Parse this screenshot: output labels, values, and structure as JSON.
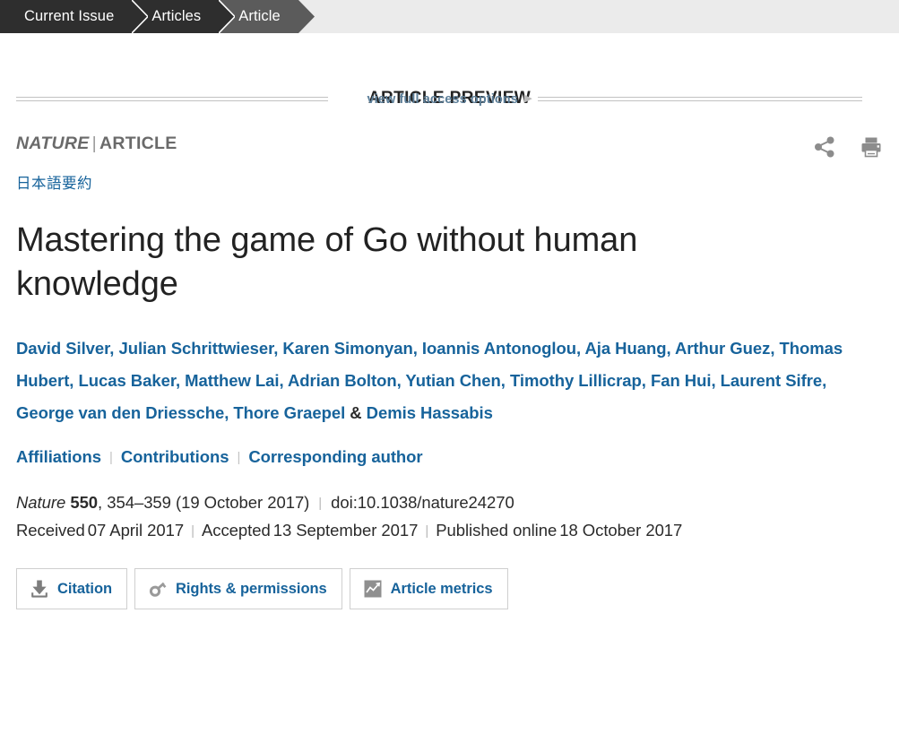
{
  "breadcrumb": {
    "items": [
      {
        "label": "Current Issue",
        "state": "dark"
      },
      {
        "label": "Articles",
        "state": "dark"
      },
      {
        "label": "Article",
        "state": "current"
      }
    ]
  },
  "preview": {
    "title": "ARTICLE PREVIEW",
    "subtitle": "view full access options",
    "caret": "▶"
  },
  "kicker": {
    "journal": "NATURE",
    "separator": "|",
    "type": "ARTICLE"
  },
  "tools": {
    "share_icon": "share-icon",
    "print_icon": "print-icon"
  },
  "japanese_summary_link": "日本語要約",
  "article": {
    "title": "Mastering the game of Go without human knowledge",
    "authors_text": "David Silver, Julian Schrittwieser, Karen Simonyan, Ioannis Antonoglou, Aja Huang, Arthur Guez, Thomas Hubert, Lucas Baker, Matthew Lai, Adrian Bolton, Yutian Chen, Timothy Lillicrap, Fan Hui, Laurent Sifre, George van den Driessche, Thore Graepel",
    "authors_conjunction": "&",
    "last_author": "Demis Hassabis",
    "authors": [
      "David Silver",
      "Julian Schrittwieser",
      "Karen Simonyan",
      "Ioannis Antonoglou",
      "Aja Huang",
      "Arthur Guez",
      "Thomas Hubert",
      "Lucas Baker",
      "Matthew Lai",
      "Adrian Bolton",
      "Yutian Chen",
      "Timothy Lillicrap",
      "Fan Hui",
      "Laurent Sifre",
      "George van den Driessche",
      "Thore Graepel",
      "Demis Hassabis"
    ]
  },
  "meta_links": {
    "affiliations": "Affiliations",
    "contributions": "Contributions",
    "corresponding_author": "Corresponding author",
    "separator": "|"
  },
  "citation": {
    "journal": "Nature",
    "volume": "550",
    "comma": ",",
    "pages": "354–359",
    "date": "(19 October 2017)",
    "separator": "|",
    "doi": "doi:10.1038/nature24270"
  },
  "history": {
    "received_label": "Received",
    "received_date": "07 April 2017",
    "accepted_label": "Accepted",
    "accepted_date": "13 September 2017",
    "published_label": "Published online",
    "published_date": "18 October 2017",
    "separator": "|"
  },
  "buttons": [
    {
      "label": "Citation",
      "icon": "download-icon"
    },
    {
      "label": "Rights & permissions",
      "icon": "key-icon"
    },
    {
      "label": "Article metrics",
      "icon": "chart-icon"
    }
  ],
  "colors": {
    "link_blue": "#17639b",
    "breadcrumb_dark": "#2e2e2e",
    "breadcrumb_current": "#5b5b5b",
    "breadcrumb_background": "#ebebeb",
    "muted_gray": "#6a6a6a",
    "preview_sub_blue": "#5d7f99"
  }
}
